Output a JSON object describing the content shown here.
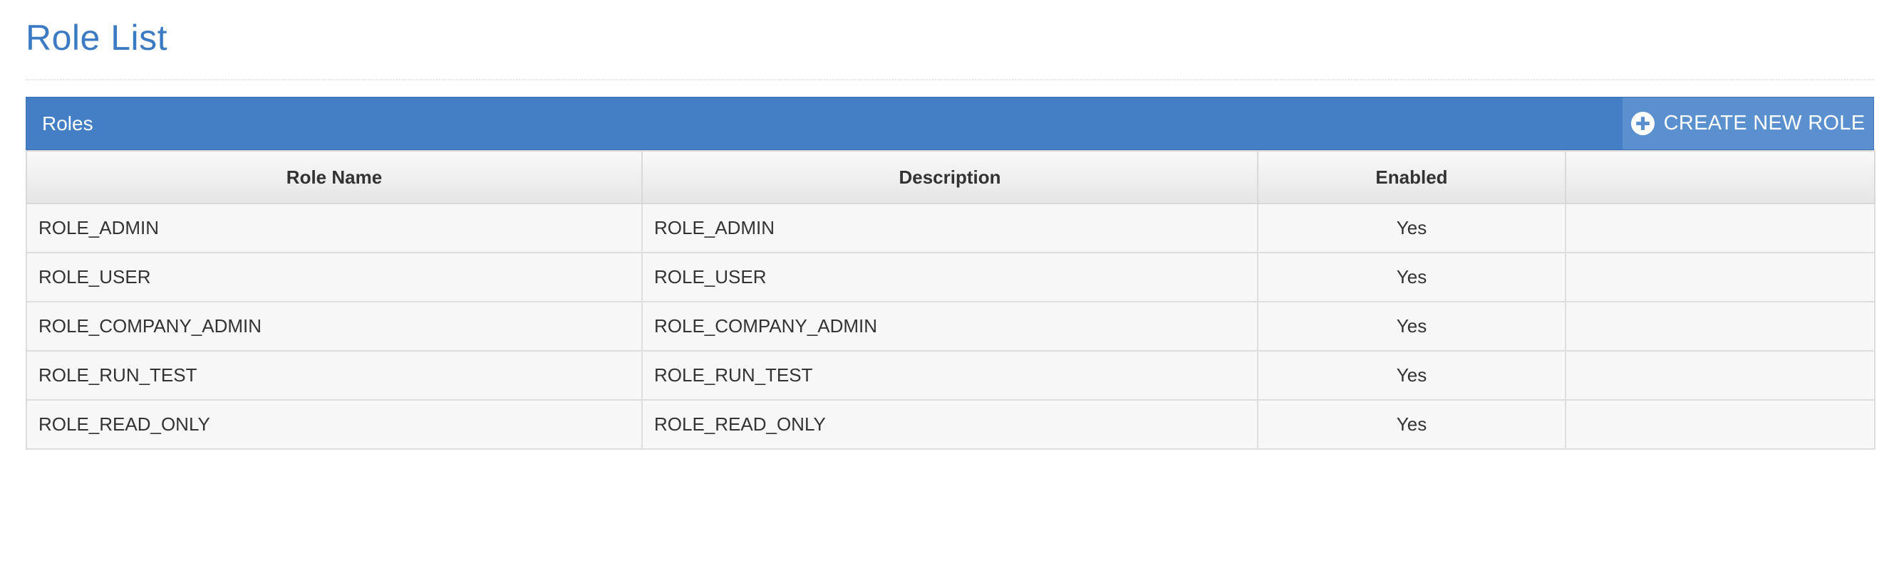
{
  "page": {
    "title": "Role List"
  },
  "panel": {
    "title": "Roles",
    "create_button_label": "CREATE NEW ROLE",
    "create_button_icon": "plus-circle-icon",
    "header_color": "#447fc5",
    "title_color": "#3c7bc4"
  },
  "table": {
    "columns": [
      "Role Name",
      "Description",
      "Enabled",
      ""
    ],
    "rows": [
      {
        "name": "ROLE_ADMIN",
        "description": "ROLE_ADMIN",
        "enabled": "Yes"
      },
      {
        "name": "ROLE_USER",
        "description": "ROLE_USER",
        "enabled": "Yes"
      },
      {
        "name": "ROLE_COMPANY_ADMIN",
        "description": "ROLE_COMPANY_ADMIN",
        "enabled": "Yes"
      },
      {
        "name": "ROLE_RUN_TEST",
        "description": "ROLE_RUN_TEST",
        "enabled": "Yes"
      },
      {
        "name": "ROLE_READ_ONLY",
        "description": "ROLE_READ_ONLY",
        "enabled": "Yes"
      }
    ]
  }
}
